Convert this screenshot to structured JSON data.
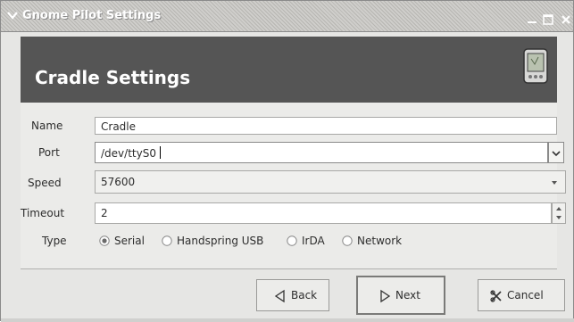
{
  "window": {
    "title": "Gnome Pilot Settings"
  },
  "header": {
    "title": "Cradle Settings",
    "icon": "handheld-device-icon"
  },
  "form": {
    "name_label": "Name",
    "name_value": "Cradle",
    "port_label": "Port",
    "port_value": "/dev/ttyS0",
    "speed_label": "Speed",
    "speed_value": "57600",
    "timeout_label": "Timeout",
    "timeout_value": "2",
    "type_label": "Type",
    "type_options": [
      {
        "label": "Serial",
        "selected": true
      },
      {
        "label": "Handspring USB",
        "selected": false
      },
      {
        "label": "IrDA",
        "selected": false
      },
      {
        "label": "Network",
        "selected": false
      }
    ]
  },
  "buttons": {
    "back_label": "Back",
    "next_label": "Next",
    "cancel_label": "Cancel"
  },
  "colors": {
    "header_bg": "#555555",
    "content_bg": "#ebebe9",
    "window_bg": "#e6e6e4"
  }
}
